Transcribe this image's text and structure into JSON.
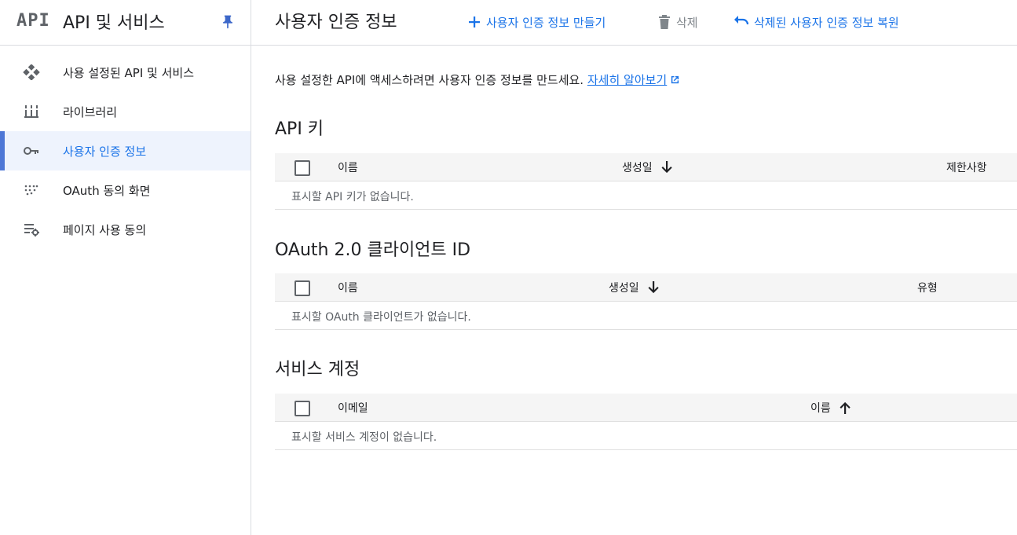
{
  "sidebar": {
    "logo": "API",
    "title": "API 및 서비스",
    "pin_icon": "pin-icon",
    "items": [
      {
        "label": "사용 설정된 API 및 서비스",
        "icon": "api-diamond-icon",
        "active": false
      },
      {
        "label": "라이브러리",
        "icon": "library-icon",
        "active": false
      },
      {
        "label": "사용자 인증 정보",
        "icon": "key-icon",
        "active": true
      },
      {
        "label": "OAuth 동의 화면",
        "icon": "dotted-grid-icon",
        "active": false
      },
      {
        "label": "페이지 사용 동의",
        "icon": "settings-list-icon",
        "active": false
      }
    ]
  },
  "topbar": {
    "title": "사용자 인증 정보",
    "create_label": "사용자 인증 정보 만들기",
    "delete_label": "삭제",
    "restore_label": "삭제된 사용자 인증 정보 복원"
  },
  "main": {
    "intro_text": "사용 설정한 API에 액세스하려면 사용자 인증 정보를 만드세요. ",
    "learn_more": "자세히 알아보기",
    "api_keys": {
      "title": "API 키",
      "columns": [
        "이름",
        "생성일",
        "제한사항"
      ],
      "empty": "표시할 API 키가 없습니다."
    },
    "oauth": {
      "title": "OAuth 2.0 클라이언트 ID",
      "columns": [
        "이름",
        "생성일",
        "유형"
      ],
      "empty": "표시할 OAuth 클라이언트가 없습니다."
    },
    "service_accounts": {
      "title": "서비스 계정",
      "columns": [
        "이메일",
        "이름"
      ],
      "empty": "표시할 서비스 계정이 없습니다."
    }
  },
  "colors": {
    "accent": "#1a73e8",
    "active_bg": "#eef3fd",
    "active_bar": "#4e77d6",
    "header_bg": "#f5f5f5"
  }
}
